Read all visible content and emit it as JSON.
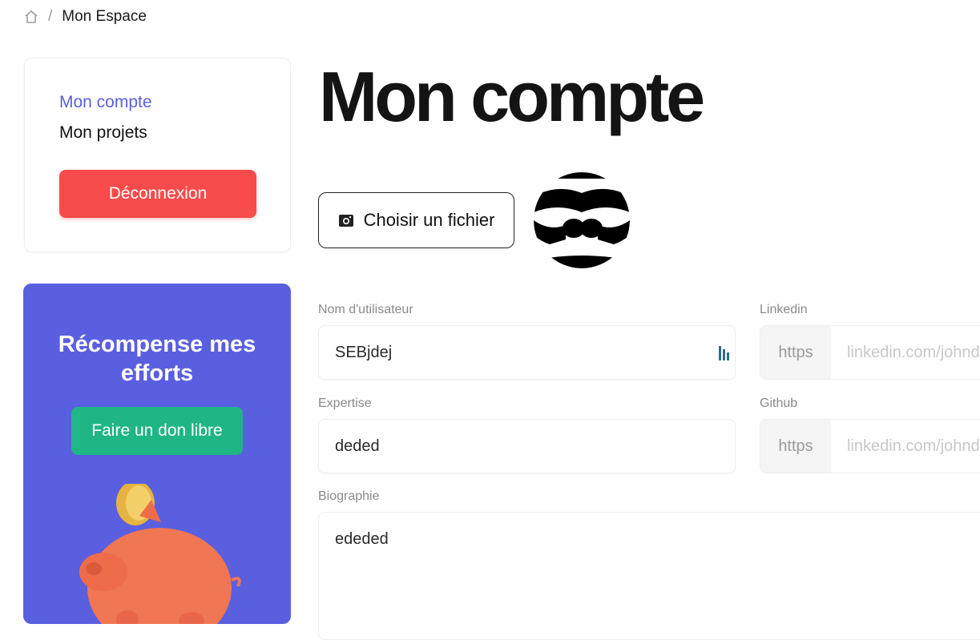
{
  "breadcrumb": {
    "separator": "/",
    "current": "Mon Espace"
  },
  "sidebar": {
    "links": [
      {
        "label": "Mon compte",
        "active": true
      },
      {
        "label": "Mon projets",
        "active": false
      }
    ],
    "logout_label": "Déconnexion",
    "promo": {
      "title": "Récompense mes efforts",
      "donate_label": "Faire un don libre"
    }
  },
  "main": {
    "title": "Mon compte",
    "file_button_label": "Choisir un fichier",
    "fields": {
      "username": {
        "label": "Nom d'utilisateur",
        "value": "SEBjdej"
      },
      "expertise": {
        "label": "Expertise",
        "value": "deded"
      },
      "biography": {
        "label": "Biographie",
        "value": "ededed"
      },
      "linkedin": {
        "label": "Linkedin",
        "prefix": "https",
        "placeholder": "linkedin.com/johndoe"
      },
      "github": {
        "label": "Github",
        "prefix": "https",
        "placeholder": "linkedin.com/johndoe"
      }
    }
  },
  "colors": {
    "accent": "#5b5fe0",
    "danger": "#f84b4b",
    "success": "#1fb585",
    "promo_bg": "#5a5fe0"
  },
  "icons": {
    "home": "home-icon",
    "camera": "camera-icon",
    "password_manager": "password-manager-icon"
  }
}
